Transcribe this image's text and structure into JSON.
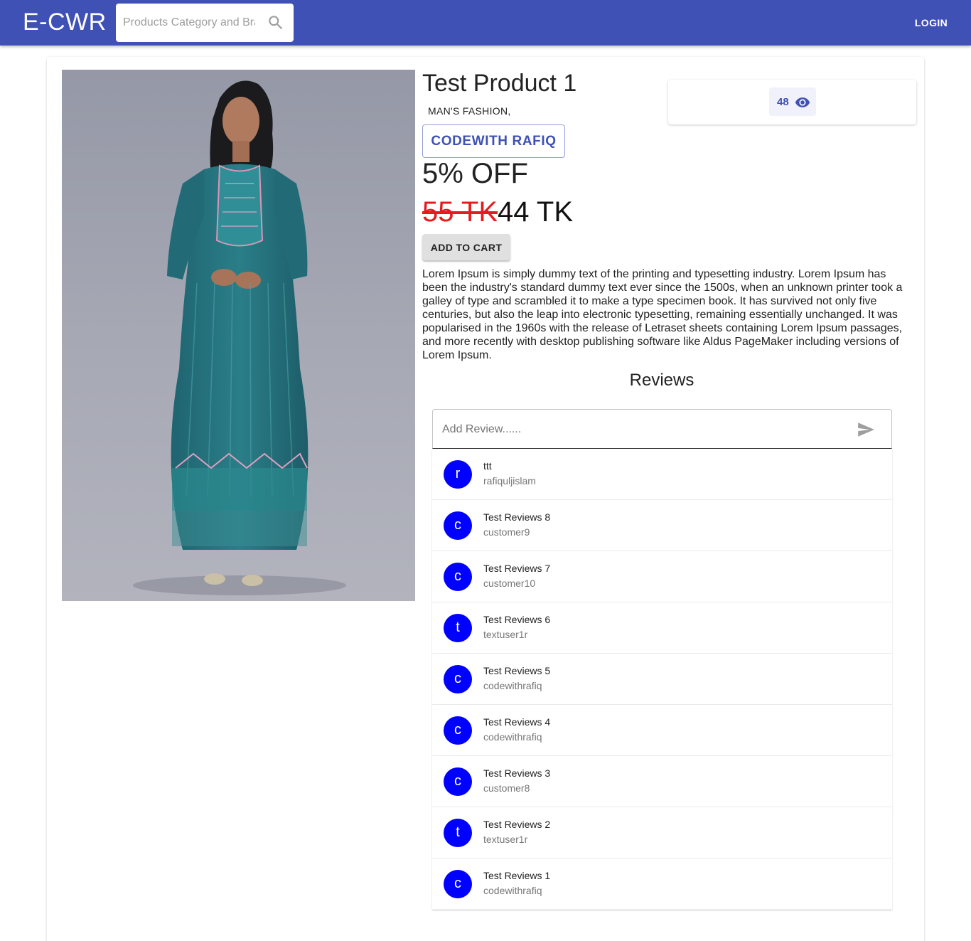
{
  "header": {
    "brand": "E-CWR",
    "search_placeholder": "Products Category and Brands",
    "search_icon": "search-icon",
    "login_label": "LOGIN",
    "bar_color": "#3f51b5"
  },
  "product": {
    "title": "Test Product 1",
    "category": "MAN'S FASHION,",
    "seller": "CODEWITH RAFIQ",
    "discount": "5% OFF",
    "old_price": "55 TK",
    "new_price": "44 TK",
    "add_to_cart": "ADD TO CART",
    "description": "Lorem Ipsum is simply dummy text of the printing and typesetting industry. Lorem Ipsum has been the industry's standard dummy text ever since the 1500s, when an unknown printer took a galley of type and scrambled it to make a type specimen book. It has survived not only five centuries, but also the leap into electronic typesetting, remaining essentially unchanged. It was popularised in the 1960s with the release of Letraset sheets containing Lorem Ipsum passages, and more recently with desktop publishing software like Aldus PageMaker including versions of Lorem Ipsum.",
    "views": "48",
    "views_icon": "eye-icon"
  },
  "reviews": {
    "title": "Reviews",
    "input_placeholder": "Add Review......",
    "send_icon": "send-icon",
    "avatar_color": "#0000ff",
    "items": [
      {
        "initial": "r",
        "text": "ttt",
        "user": "rafiquljislam"
      },
      {
        "initial": "c",
        "text": "Test Reviews 8",
        "user": "customer9"
      },
      {
        "initial": "c",
        "text": "Test Reviews 7",
        "user": "customer10"
      },
      {
        "initial": "t",
        "text": "Test Reviews 6",
        "user": "textuser1r"
      },
      {
        "initial": "c",
        "text": "Test Reviews 5",
        "user": "codewithrafiq"
      },
      {
        "initial": "c",
        "text": "Test Reviews 4",
        "user": "codewithrafiq"
      },
      {
        "initial": "c",
        "text": "Test Reviews 3",
        "user": "customer8"
      },
      {
        "initial": "t",
        "text": "Test Reviews 2",
        "user": "textuser1r"
      },
      {
        "initial": "c",
        "text": "Test Reviews 1",
        "user": "codewithrafiq"
      }
    ]
  }
}
